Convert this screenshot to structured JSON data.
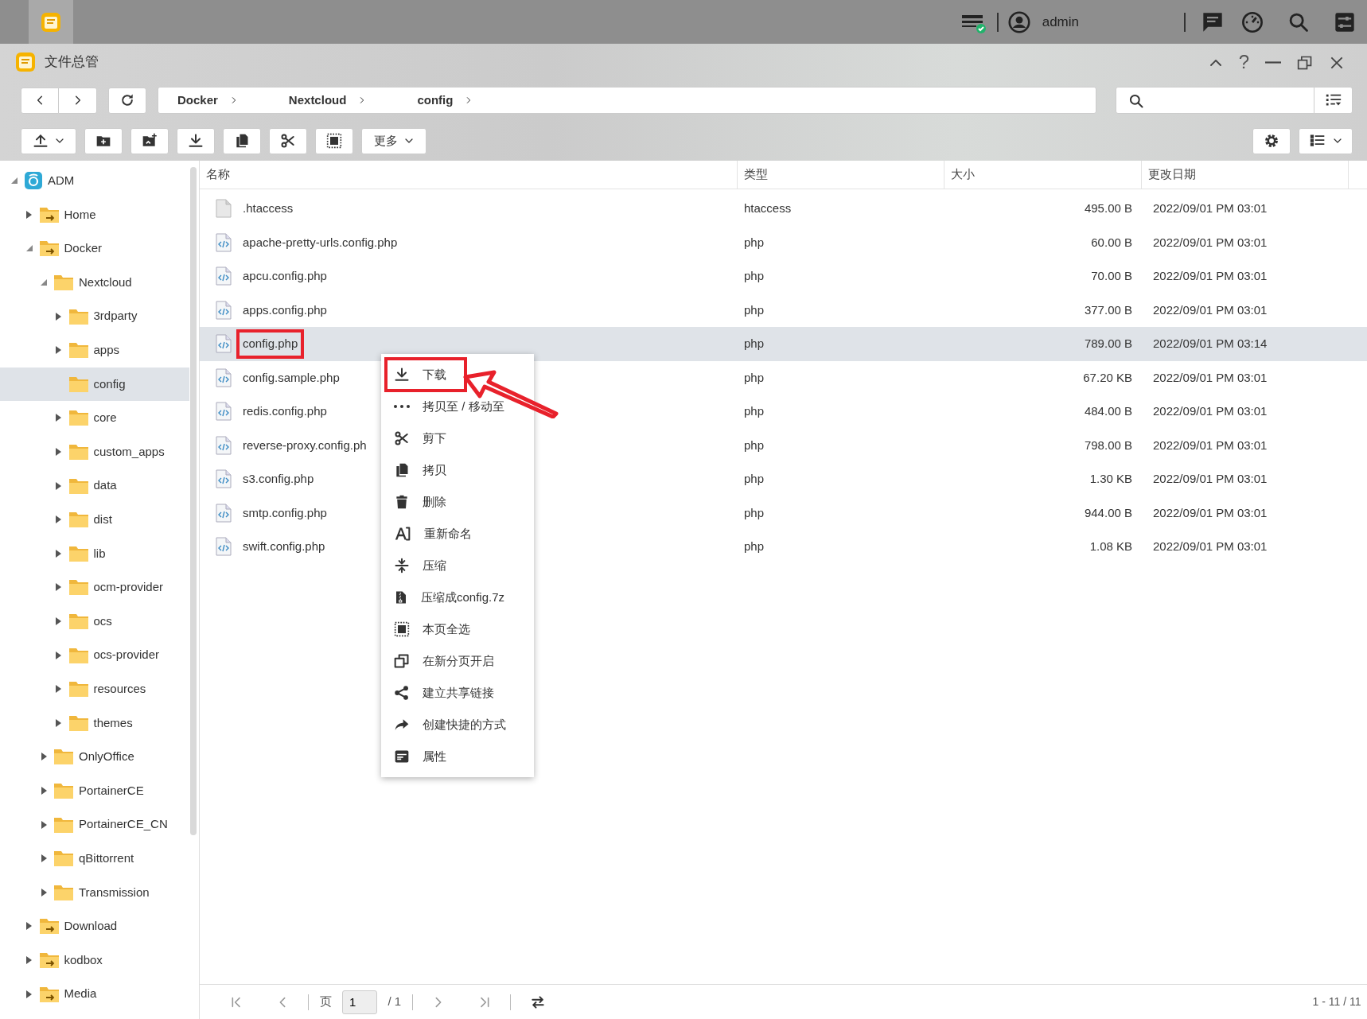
{
  "top_bar": {
    "user": "admin"
  },
  "window": {
    "title": "文件总管",
    "help": "?"
  },
  "breadcrumb": [
    "Docker",
    "Nextcloud",
    "config"
  ],
  "toolbar": {
    "more": "更多"
  },
  "tree": [
    {
      "label": "ADM",
      "kind": "volume",
      "expanded": true,
      "selected": false,
      "children": [
        {
          "label": "Home",
          "kind": "shared",
          "expanded": false,
          "selected": false
        },
        {
          "label": "Docker",
          "kind": "shared",
          "expanded": true,
          "selected": false,
          "children": [
            {
              "label": "Nextcloud",
              "kind": "folder",
              "expanded": true,
              "selected": false,
              "children": [
                {
                  "label": "3rdparty",
                  "kind": "folder",
                  "expanded": false,
                  "selected": false
                },
                {
                  "label": "apps",
                  "kind": "folder",
                  "expanded": false,
                  "selected": false
                },
                {
                  "label": "config",
                  "kind": "folder",
                  "selected": true
                },
                {
                  "label": "core",
                  "kind": "folder",
                  "expanded": false,
                  "selected": false
                },
                {
                  "label": "custom_apps",
                  "kind": "folder",
                  "expanded": false,
                  "selected": false
                },
                {
                  "label": "data",
                  "kind": "folder",
                  "expanded": false,
                  "selected": false
                },
                {
                  "label": "dist",
                  "kind": "folder",
                  "expanded": false,
                  "selected": false
                },
                {
                  "label": "lib",
                  "kind": "folder",
                  "expanded": false,
                  "selected": false
                },
                {
                  "label": "ocm-provider",
                  "kind": "folder",
                  "expanded": false,
                  "selected": false
                },
                {
                  "label": "ocs",
                  "kind": "folder",
                  "expanded": false,
                  "selected": false
                },
                {
                  "label": "ocs-provider",
                  "kind": "folder",
                  "expanded": false,
                  "selected": false
                },
                {
                  "label": "resources",
                  "kind": "folder",
                  "expanded": false,
                  "selected": false
                },
                {
                  "label": "themes",
                  "kind": "folder",
                  "expanded": false,
                  "selected": false
                }
              ]
            },
            {
              "label": "OnlyOffice",
              "kind": "folder",
              "expanded": false,
              "selected": false
            },
            {
              "label": "PortainerCE",
              "kind": "folder",
              "expanded": false,
              "selected": false
            },
            {
              "label": "PortainerCE_CN",
              "kind": "folder",
              "expanded": false,
              "selected": false
            },
            {
              "label": "qBittorrent",
              "kind": "folder",
              "expanded": false,
              "selected": false
            },
            {
              "label": "Transmission",
              "kind": "folder",
              "expanded": false,
              "selected": false
            }
          ]
        },
        {
          "label": "Download",
          "kind": "shared",
          "expanded": false,
          "selected": false
        },
        {
          "label": "kodbox",
          "kind": "shared",
          "expanded": false,
          "selected": false
        },
        {
          "label": "Media",
          "kind": "shared",
          "expanded": false,
          "selected": false
        }
      ]
    }
  ],
  "table": {
    "columns": [
      "名称",
      "类型",
      "大小",
      "更改日期"
    ],
    "rows": [
      {
        "name": ".htaccess",
        "kind": "plain",
        "type": "htaccess",
        "size": "495.00 B",
        "modified": "2022/09/01 PM 03:01",
        "selected": false,
        "annotated": false
      },
      {
        "name": "apache-pretty-urls.config.php",
        "kind": "code",
        "type": "php",
        "size": "60.00 B",
        "modified": "2022/09/01 PM 03:01",
        "selected": false,
        "annotated": false
      },
      {
        "name": "apcu.config.php",
        "kind": "code",
        "type": "php",
        "size": "70.00 B",
        "modified": "2022/09/01 PM 03:01",
        "selected": false,
        "annotated": false
      },
      {
        "name": "apps.config.php",
        "kind": "code",
        "type": "php",
        "size": "377.00 B",
        "modified": "2022/09/01 PM 03:01",
        "selected": false,
        "annotated": false
      },
      {
        "name": "config.php",
        "kind": "code",
        "type": "php",
        "size": "789.00 B",
        "modified": "2022/09/01 PM 03:14",
        "selected": true,
        "annotated": true
      },
      {
        "name": "config.sample.php",
        "kind": "code",
        "type": "php",
        "size": "67.20 KB",
        "modified": "2022/09/01 PM 03:01",
        "selected": false,
        "annotated": false
      },
      {
        "name": "redis.config.php",
        "kind": "code",
        "type": "php",
        "size": "484.00 B",
        "modified": "2022/09/01 PM 03:01",
        "selected": false,
        "annotated": false
      },
      {
        "name": "reverse-proxy.config.ph",
        "kind": "code",
        "type": "php",
        "size": "798.00 B",
        "modified": "2022/09/01 PM 03:01",
        "selected": false,
        "annotated": false
      },
      {
        "name": "s3.config.php",
        "kind": "code",
        "type": "php",
        "size": "1.30 KB",
        "modified": "2022/09/01 PM 03:01",
        "selected": false,
        "annotated": false
      },
      {
        "name": "smtp.config.php",
        "kind": "code",
        "type": "php",
        "size": "944.00 B",
        "modified": "2022/09/01 PM 03:01",
        "selected": false,
        "annotated": false
      },
      {
        "name": "swift.config.php",
        "kind": "code",
        "type": "php",
        "size": "1.08 KB",
        "modified": "2022/09/01 PM 03:01",
        "selected": false,
        "annotated": false
      }
    ]
  },
  "context_menu": {
    "arrow": true,
    "items": [
      {
        "label": "下载",
        "kind": "download",
        "annotated": true
      },
      {
        "label": "拷贝至 / 移动至",
        "kind": "dots",
        "annotated": false
      },
      {
        "label": "剪下",
        "kind": "cut",
        "annotated": false
      },
      {
        "label": "拷贝",
        "kind": "copy",
        "annotated": false
      },
      {
        "label": "删除",
        "kind": "trash",
        "annotated": false
      },
      {
        "label": "重新命名",
        "kind": "rename",
        "annotated": false
      },
      {
        "label": "压缩",
        "kind": "compress",
        "annotated": false
      },
      {
        "label": "压缩成config.7z",
        "kind": "archive",
        "annotated": false
      },
      {
        "label": "本页全选",
        "kind": "selectall",
        "annotated": false
      },
      {
        "label": "在新分页开启",
        "kind": "newtab",
        "annotated": false
      },
      {
        "label": "建立共享链接",
        "kind": "share",
        "annotated": false
      },
      {
        "label": "创建快捷的方式",
        "kind": "shortcut",
        "annotated": false
      },
      {
        "label": "属性",
        "kind": "properties",
        "annotated": false
      }
    ]
  },
  "pager": {
    "page_label": "页",
    "page": "1",
    "total": "/ 1",
    "range": "1 - 11 / 11"
  }
}
